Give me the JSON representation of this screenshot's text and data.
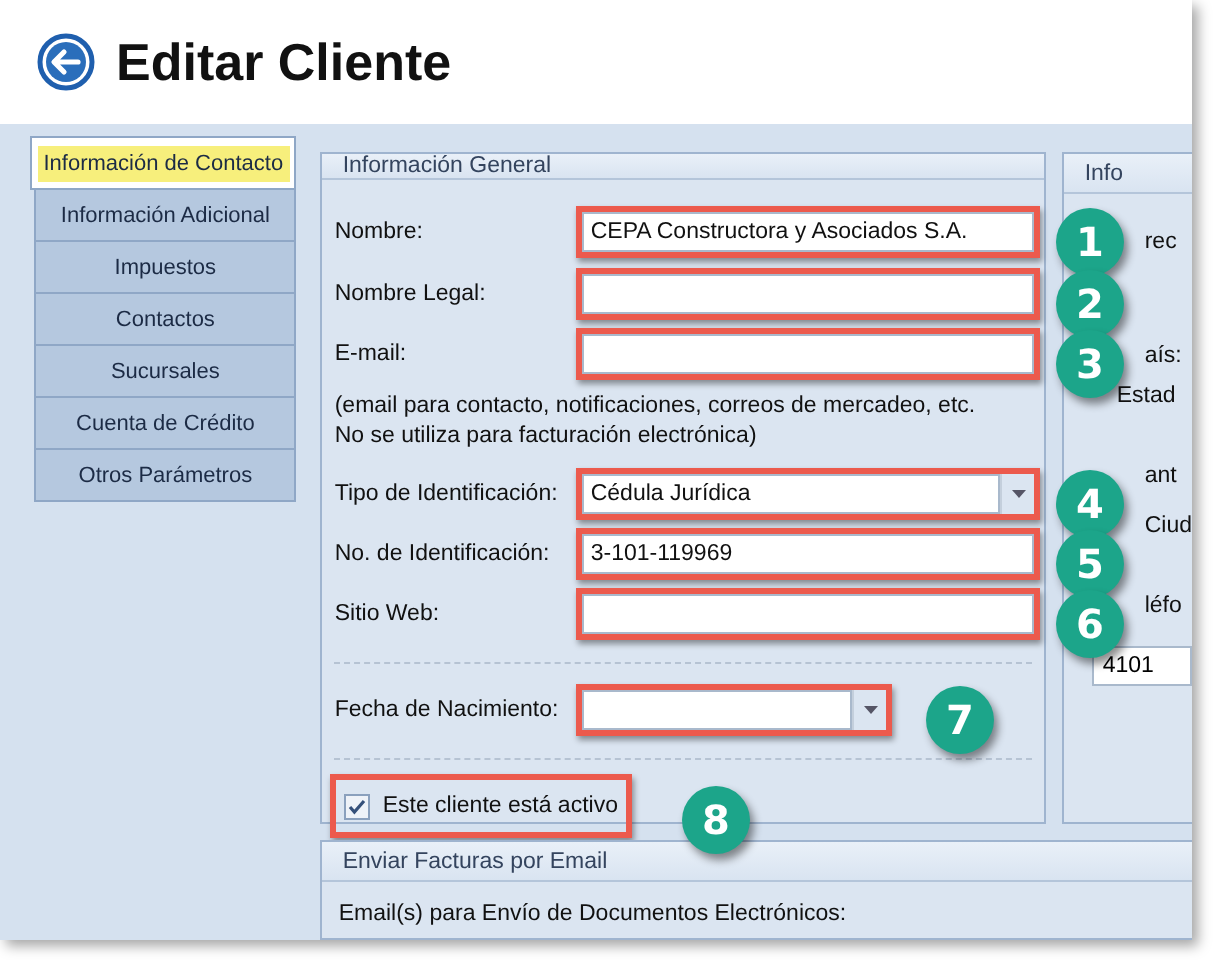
{
  "title": "Editar Cliente",
  "sidebar": [
    {
      "label": "Información de Contacto",
      "selected": true
    },
    {
      "label": "Información Adicional",
      "selected": false
    },
    {
      "label": "Impuestos",
      "selected": false
    },
    {
      "label": "Contactos",
      "selected": false
    },
    {
      "label": "Sucursales",
      "selected": false
    },
    {
      "label": "Cuenta de Crédito",
      "selected": false
    },
    {
      "label": "Otros Parámetros",
      "selected": false
    }
  ],
  "general": {
    "title": "Información General",
    "items": [
      {
        "kind": "text",
        "label": "Nombre:",
        "value": "CEPA Constructora y Asociados S.A.",
        "badge": "1"
      },
      {
        "kind": "text",
        "label": "Nombre Legal:",
        "badge": "2"
      },
      {
        "kind": "text",
        "label": "E-mail:",
        "badge": "3"
      },
      {
        "kind": "note",
        "lines": [
          "(email para contacto, notificaciones, correos de mercadeo, etc.",
          "No se utiliza para facturación electrónica)"
        ]
      },
      {
        "kind": "select",
        "label": "Tipo de Identificación:",
        "value": "Cédula Jurídica",
        "badge": "4"
      },
      {
        "kind": "text",
        "label": "No. de Identificación:",
        "value": "3-101-119969",
        "badge": "5"
      },
      {
        "kind": "text",
        "label": "Sitio Web:",
        "badge": "6"
      },
      {
        "kind": "divider"
      },
      {
        "kind": "date",
        "label": "Fecha de Nacimiento:",
        "badge": "7"
      },
      {
        "kind": "divider"
      },
      {
        "kind": "checkbox",
        "label": "Este cliente está activo",
        "checked": true,
        "badge": "8"
      }
    ]
  },
  "side_panel": {
    "title": "Info",
    "labels": [
      "rec",
      "aís:",
      "Estad",
      "ant",
      "Ciud",
      "léfo"
    ],
    "value": "4101"
  },
  "email_panel": {
    "title": "Enviar Facturas por Email",
    "text": "Email(s) para Envío de Documentos Electrónicos:"
  }
}
